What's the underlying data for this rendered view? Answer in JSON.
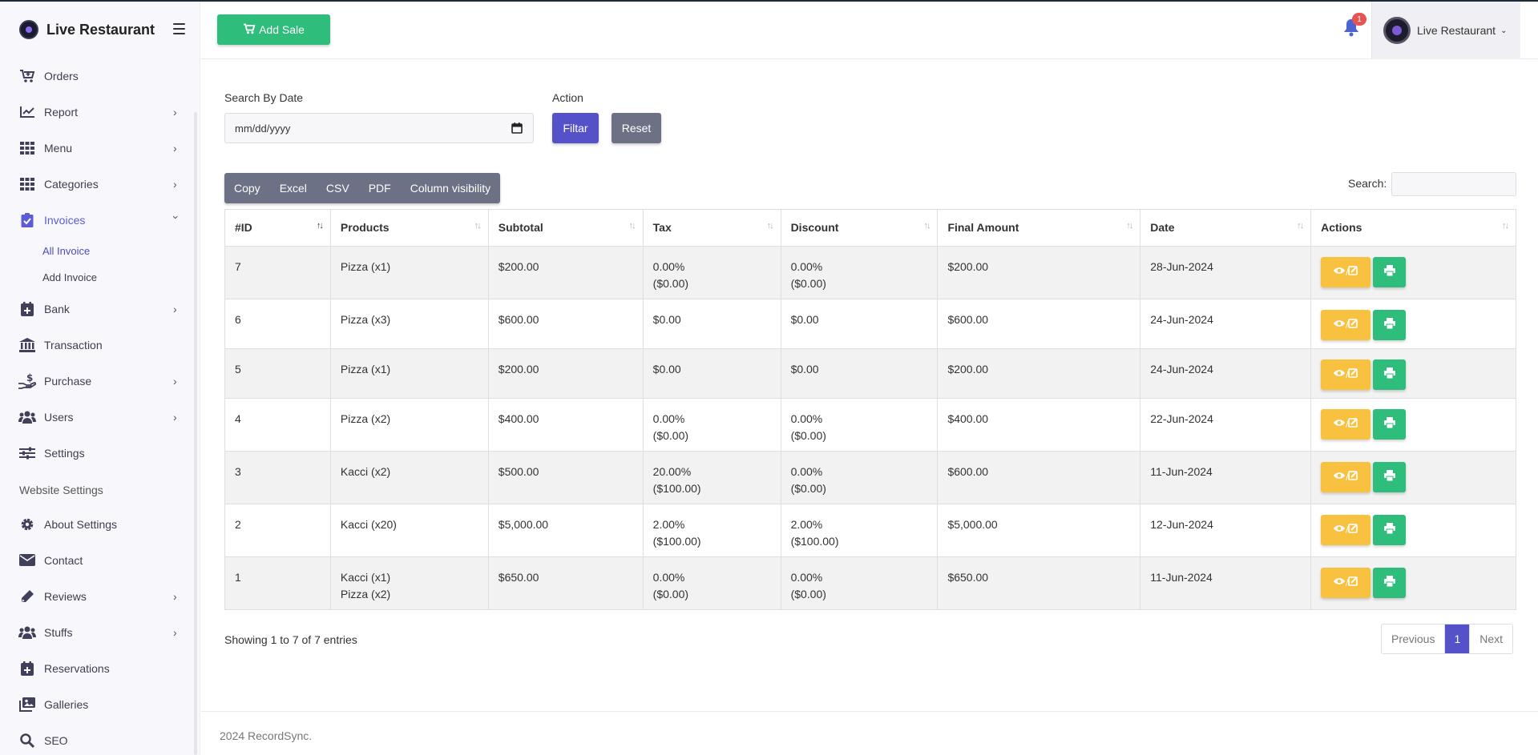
{
  "sidebar": {
    "brand": "Live Restaurant",
    "items": [
      {
        "label": "Orders",
        "icon": "cart-icon"
      },
      {
        "label": "Report",
        "icon": "chart-line-icon"
      },
      {
        "label": "Menu",
        "icon": "grid-icon"
      },
      {
        "label": "Categories",
        "icon": "grid-icon"
      },
      {
        "label": "Invoices",
        "icon": "clipboard-check-icon"
      },
      {
        "label": "Bank",
        "icon": "bank-plus-icon"
      },
      {
        "label": "Transaction",
        "icon": "bank-icon"
      },
      {
        "label": "Purchase",
        "icon": "hand-dollar-icon"
      },
      {
        "label": "Users",
        "icon": "users-icon"
      },
      {
        "label": "Settings",
        "icon": "sliders-icon"
      }
    ],
    "invoice_sub": [
      "All Invoice",
      "Add Invoice"
    ],
    "section_title": "Website Settings",
    "website_items": [
      {
        "label": "About Settings",
        "icon": "gear-icon"
      },
      {
        "label": "Contact",
        "icon": "envelope-icon"
      },
      {
        "label": "Reviews",
        "icon": "pencil-icon"
      },
      {
        "label": "Stuffs",
        "icon": "users-icon"
      },
      {
        "label": "Reservations",
        "icon": "calendar-plus-icon"
      },
      {
        "label": "Galleries",
        "icon": "images-icon"
      },
      {
        "label": "SEO",
        "icon": "search-icon"
      }
    ]
  },
  "header": {
    "add_sale": "Add Sale",
    "notification_count": "1",
    "profile_name": "Live Restaurant"
  },
  "filters": {
    "search_by_date_label": "Search By Date",
    "date_placeholder": "mm/dd/yyyy",
    "action_label": "Action",
    "filter_button": "Filtar",
    "reset_button": "Reset"
  },
  "export_buttons": [
    "Copy",
    "Excel",
    "CSV",
    "PDF",
    "Column visibility"
  ],
  "search_label": "Search:",
  "table": {
    "columns": [
      "#ID",
      "Products",
      "Subtotal",
      "Tax",
      "Discount",
      "Final Amount",
      "Date",
      "Actions"
    ],
    "rows": [
      {
        "id": "7",
        "products": [
          "Pizza (x1)"
        ],
        "subtotal": "$200.00",
        "tax": [
          "0.00%",
          "($0.00)"
        ],
        "discount": [
          "0.00%",
          "($0.00)"
        ],
        "final": "$200.00",
        "date": "28-Jun-2024"
      },
      {
        "id": "6",
        "products": [
          "Pizza (x3)"
        ],
        "subtotal": "$600.00",
        "tax": [
          "$0.00"
        ],
        "discount": [
          "$0.00"
        ],
        "final": "$600.00",
        "date": "24-Jun-2024"
      },
      {
        "id": "5",
        "products": [
          "Pizza (x1)"
        ],
        "subtotal": "$200.00",
        "tax": [
          "$0.00"
        ],
        "discount": [
          "$0.00"
        ],
        "final": "$200.00",
        "date": "24-Jun-2024"
      },
      {
        "id": "4",
        "products": [
          "Pizza (x2)"
        ],
        "subtotal": "$400.00",
        "tax": [
          "0.00%",
          "($0.00)"
        ],
        "discount": [
          "0.00%",
          "($0.00)"
        ],
        "final": "$400.00",
        "date": "22-Jun-2024"
      },
      {
        "id": "3",
        "products": [
          "Kacci (x2)"
        ],
        "subtotal": "$500.00",
        "tax": [
          "20.00%",
          "($100.00)"
        ],
        "discount": [
          "0.00%",
          "($0.00)"
        ],
        "final": "$600.00",
        "date": "11-Jun-2024"
      },
      {
        "id": "2",
        "products": [
          "Kacci (x20)"
        ],
        "subtotal": "$5,000.00",
        "tax": [
          "2.00%",
          "($100.00)"
        ],
        "discount": [
          "2.00%",
          "($100.00)"
        ],
        "final": "$5,000.00",
        "date": "12-Jun-2024"
      },
      {
        "id": "1",
        "products": [
          "Kacci (x1)",
          "Pizza (x2)"
        ],
        "subtotal": "$650.00",
        "tax": [
          "0.00%",
          "($0.00)"
        ],
        "discount": [
          "0.00%",
          "($0.00)"
        ],
        "final": "$650.00",
        "date": "11-Jun-2024"
      }
    ]
  },
  "pagination": {
    "info": "Showing 1 to 7 of 7 entries",
    "previous": "Previous",
    "current": "1",
    "next": "Next"
  },
  "footer": {
    "text": "2024 RecordSync."
  },
  "colors": {
    "primary": "#5552c9",
    "success": "#2ebd7a",
    "warning": "#f8c240",
    "secondary": "#6c7185",
    "danger": "#e55353"
  }
}
